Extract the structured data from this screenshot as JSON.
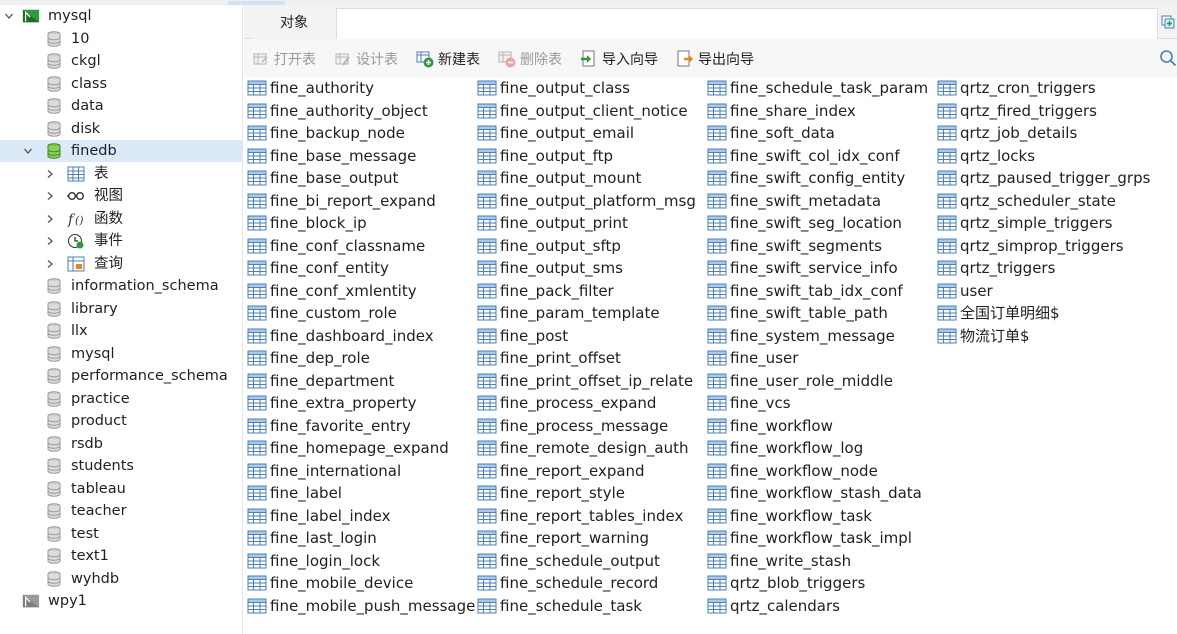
{
  "tree": {
    "connection": {
      "label": "mysql"
    },
    "databases_top": [
      "10",
      "ckgl",
      "class",
      "data",
      "disk"
    ],
    "selected_db": {
      "label": "finedb"
    },
    "categories": [
      {
        "label": "表",
        "icon": "table-category-icon"
      },
      {
        "label": "视图",
        "icon": "view-category-icon"
      },
      {
        "label": "函数",
        "icon": "function-category-icon"
      },
      {
        "label": "事件",
        "icon": "event-category-icon"
      },
      {
        "label": "查询",
        "icon": "query-category-icon"
      }
    ],
    "databases_bottom": [
      "information_schema",
      "library",
      "llx",
      "mysql",
      "performance_schema",
      "practice",
      "product",
      "rsdb",
      "students",
      "tableau",
      "teacher",
      "test",
      "text1",
      "wyhdb"
    ],
    "connection2": {
      "label": "wpy1"
    }
  },
  "tabs": {
    "objects_label": "对象"
  },
  "toolbar": {
    "open_table": "打开表",
    "design_table": "设计表",
    "new_table": "新建表",
    "delete_table": "删除表",
    "import_wizard": "导入向导",
    "export_wizard": "导出向导"
  },
  "tables": {
    "column1": [
      "fine_authority",
      "fine_authority_object",
      "fine_backup_node",
      "fine_base_message",
      "fine_base_output",
      "fine_bi_report_expand",
      "fine_block_ip",
      "fine_conf_classname",
      "fine_conf_entity",
      "fine_conf_xmlentity",
      "fine_custom_role",
      "fine_dashboard_index",
      "fine_dep_role",
      "fine_department",
      "fine_extra_property",
      "fine_favorite_entry",
      "fine_homepage_expand",
      "fine_international",
      "fine_label",
      "fine_label_index",
      "fine_last_login",
      "fine_login_lock",
      "fine_mobile_device",
      "fine_mobile_push_message"
    ],
    "column2": [
      "fine_output_class",
      "fine_output_client_notice",
      "fine_output_email",
      "fine_output_ftp",
      "fine_output_mount",
      "fine_output_platform_msg",
      "fine_output_print",
      "fine_output_sftp",
      "fine_output_sms",
      "fine_pack_filter",
      "fine_param_template",
      "fine_post",
      "fine_print_offset",
      "fine_print_offset_ip_relate",
      "fine_process_expand",
      "fine_process_message",
      "fine_remote_design_auth",
      "fine_report_expand",
      "fine_report_style",
      "fine_report_tables_index",
      "fine_report_warning",
      "fine_schedule_output",
      "fine_schedule_record",
      "fine_schedule_task"
    ],
    "column3": [
      "fine_schedule_task_param",
      "fine_share_index",
      "fine_soft_data",
      "fine_swift_col_idx_conf",
      "fine_swift_config_entity",
      "fine_swift_metadata",
      "fine_swift_seg_location",
      "fine_swift_segments",
      "fine_swift_service_info",
      "fine_swift_tab_idx_conf",
      "fine_swift_table_path",
      "fine_system_message",
      "fine_user",
      "fine_user_role_middle",
      "fine_vcs",
      "fine_workflow",
      "fine_workflow_log",
      "fine_workflow_node",
      "fine_workflow_stash_data",
      "fine_workflow_task",
      "fine_workflow_task_impl",
      "fine_write_stash",
      "qrtz_blob_triggers",
      "qrtz_calendars"
    ],
    "column4": [
      "qrtz_cron_triggers",
      "qrtz_fired_triggers",
      "qrtz_job_details",
      "qrtz_locks",
      "qrtz_paused_trigger_grps",
      "qrtz_scheduler_state",
      "qrtz_simple_triggers",
      "qrtz_simprop_triggers",
      "qrtz_triggers",
      "user",
      "全国订单明细$",
      "物流订单$"
    ]
  },
  "colors": {
    "selection": "#dbe9f8",
    "table_icon": "#4a7fb8",
    "green": "#2e9a3a",
    "orange": "#e8841e"
  }
}
